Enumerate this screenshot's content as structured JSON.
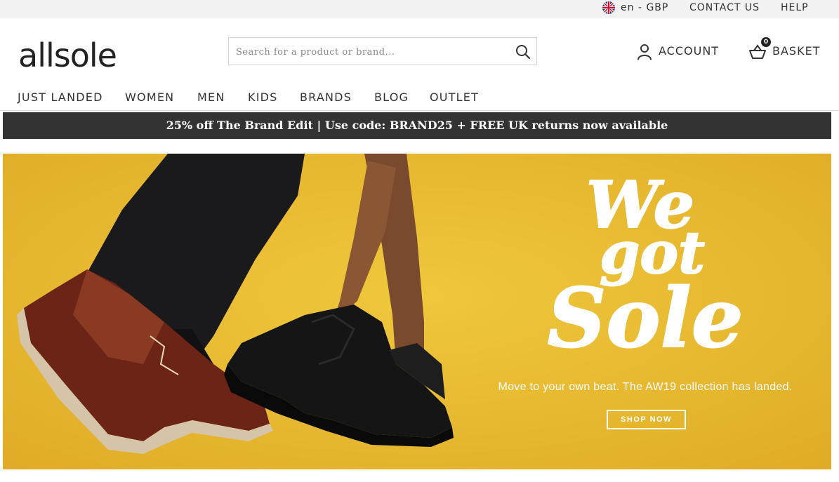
{
  "topbar": {
    "locale": "en - GBP",
    "contact": "CONTACT US",
    "help": "HELP"
  },
  "header": {
    "logo_text": "allsole",
    "search_placeholder": "Search for a product or brand...",
    "account_label": "ACCOUNT",
    "basket_label": "BASKET",
    "basket_count": "0"
  },
  "nav": {
    "items": [
      "JUST LANDED",
      "WOMEN",
      "MEN",
      "KIDS",
      "BRANDS",
      "BLOG",
      "OUTLET"
    ]
  },
  "promo": {
    "text": "25% off The Brand Edit | Use code: BRAND25 + FREE UK returns now available"
  },
  "hero": {
    "headline_lines": [
      "We",
      "got",
      "Sole"
    ],
    "tagline": "Move to your own beat. The AW19 collection has landed.",
    "cta": "SHOP NOW",
    "background_color": "#e6b62c"
  },
  "colors": {
    "promo_bar": "#333333",
    "topbar": "#f2f2f2",
    "text": "#333333"
  }
}
